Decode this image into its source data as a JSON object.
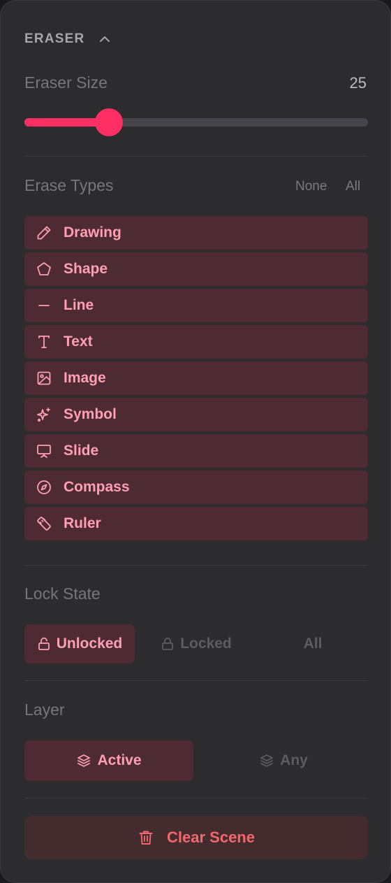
{
  "header": {
    "title": "ERASER",
    "icon": "chevron-up-icon"
  },
  "eraser_size": {
    "label": "Eraser Size",
    "value": "25",
    "fraction": 0.245,
    "accent": "#ff2e63"
  },
  "erase_types": {
    "label": "Erase Types",
    "none_label": "None",
    "all_label": "All",
    "items": [
      {
        "label": "Drawing",
        "icon": "pencil-icon"
      },
      {
        "label": "Shape",
        "icon": "pentagon-icon"
      },
      {
        "label": "Line",
        "icon": "line-icon"
      },
      {
        "label": "Text",
        "icon": "text-icon"
      },
      {
        "label": "Image",
        "icon": "image-icon"
      },
      {
        "label": "Symbol",
        "icon": "sparkles-icon"
      },
      {
        "label": "Slide",
        "icon": "presentation-icon"
      },
      {
        "label": "Compass",
        "icon": "compass-icon"
      },
      {
        "label": "Ruler",
        "icon": "ruler-icon"
      }
    ]
  },
  "lock_state": {
    "label": "Lock State",
    "options": [
      {
        "label": "Unlocked",
        "selected": true
      },
      {
        "label": "Locked",
        "selected": false
      },
      {
        "label": "All",
        "selected": false
      }
    ]
  },
  "layer": {
    "label": "Layer",
    "options": [
      {
        "label": "Active",
        "selected": true
      },
      {
        "label": "Any",
        "selected": false
      }
    ]
  },
  "clear_button": {
    "label": "Clear Scene",
    "color": "#f2686d"
  },
  "colors": {
    "panel": "#2c2c2e",
    "item_bg": "#4e2a33",
    "item_text": "#ff9fb2"
  }
}
